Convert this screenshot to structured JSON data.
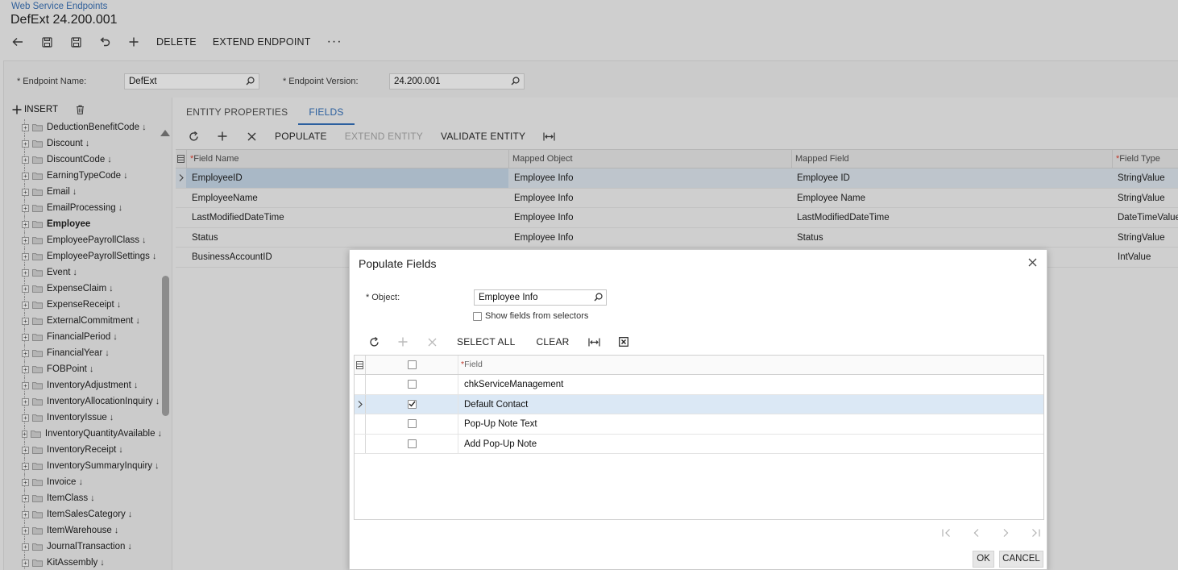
{
  "breadcrumb": "Web Service Endpoints",
  "title": "DefExt 24.200.001",
  "toolbar": {
    "delete_label": "DELETE",
    "extend_label": "EXTEND ENDPOINT",
    "more_label": "···"
  },
  "form": {
    "endpoint_name_label": "Endpoint Name:",
    "endpoint_name_value": "DefExt",
    "endpoint_version_label": "Endpoint Version:",
    "endpoint_version_value": "24.200.001",
    "required_mark": "*"
  },
  "tree": {
    "insert_label": "INSERT",
    "items": [
      {
        "label": "DeductionBenefitCode",
        "arrow": "↓",
        "bold": false
      },
      {
        "label": "Discount",
        "arrow": "↓",
        "bold": false
      },
      {
        "label": "DiscountCode",
        "arrow": "↓",
        "bold": false
      },
      {
        "label": "EarningTypeCode",
        "arrow": "↓",
        "bold": false
      },
      {
        "label": "Email",
        "arrow": "↓",
        "bold": false
      },
      {
        "label": "EmailProcessing",
        "arrow": "↓",
        "bold": false
      },
      {
        "label": "Employee",
        "arrow": "",
        "bold": true
      },
      {
        "label": "EmployeePayrollClass",
        "arrow": "↓",
        "bold": false
      },
      {
        "label": "EmployeePayrollSettings",
        "arrow": "↓",
        "bold": false
      },
      {
        "label": "Event",
        "arrow": "↓",
        "bold": false
      },
      {
        "label": "ExpenseClaim",
        "arrow": "↓",
        "bold": false
      },
      {
        "label": "ExpenseReceipt",
        "arrow": "↓",
        "bold": false
      },
      {
        "label": "ExternalCommitment",
        "arrow": "↓",
        "bold": false
      },
      {
        "label": "FinancialPeriod",
        "arrow": "↓",
        "bold": false
      },
      {
        "label": "FinancialYear",
        "arrow": "↓",
        "bold": false
      },
      {
        "label": "FOBPoint",
        "arrow": "↓",
        "bold": false
      },
      {
        "label": "InventoryAdjustment",
        "arrow": "↓",
        "bold": false
      },
      {
        "label": "InventoryAllocationInquiry",
        "arrow": "↓",
        "bold": false
      },
      {
        "label": "InventoryIssue",
        "arrow": "↓",
        "bold": false
      },
      {
        "label": "InventoryQuantityAvailable",
        "arrow": "↓",
        "bold": false
      },
      {
        "label": "InventoryReceipt",
        "arrow": "↓",
        "bold": false
      },
      {
        "label": "InventorySummaryInquiry",
        "arrow": "↓",
        "bold": false
      },
      {
        "label": "Invoice",
        "arrow": "↓",
        "bold": false
      },
      {
        "label": "ItemClass",
        "arrow": "↓",
        "bold": false
      },
      {
        "label": "ItemSalesCategory",
        "arrow": "↓",
        "bold": false
      },
      {
        "label": "ItemWarehouse",
        "arrow": "↓",
        "bold": false
      },
      {
        "label": "JournalTransaction",
        "arrow": "↓",
        "bold": false
      },
      {
        "label": "KitAssembly",
        "arrow": "↓",
        "bold": false
      }
    ]
  },
  "tabs": [
    {
      "label": "ENTITY PROPERTIES",
      "active": false
    },
    {
      "label": "FIELDS",
      "active": true
    }
  ],
  "grid_toolbar": {
    "populate_label": "POPULATE",
    "extend_entity_label": "EXTEND ENTITY",
    "validate_label": "VALIDATE ENTITY"
  },
  "grid": {
    "headers": {
      "field_name": "Field Name",
      "mapped_object": "Mapped Object",
      "mapped_field": "Mapped Field",
      "field_type": "Field Type"
    },
    "rows": [
      {
        "field_name": "EmployeeID",
        "mapped_object": "Employee Info",
        "mapped_field": "Employee ID",
        "field_type": "StringValue",
        "selected": true
      },
      {
        "field_name": "EmployeeName",
        "mapped_object": "Employee Info",
        "mapped_field": "Employee Name",
        "field_type": "StringValue",
        "selected": false
      },
      {
        "field_name": "LastModifiedDateTime",
        "mapped_object": "Employee Info",
        "mapped_field": "LastModifiedDateTime",
        "field_type": "DateTimeValue",
        "selected": false
      },
      {
        "field_name": "Status",
        "mapped_object": "Employee Info",
        "mapped_field": "Status",
        "field_type": "StringValue",
        "selected": false
      },
      {
        "field_name": "BusinessAccountID",
        "mapped_object": "",
        "mapped_field": "",
        "field_type": "IntValue",
        "selected": false
      }
    ]
  },
  "dialog": {
    "title": "Populate Fields",
    "object_label": "Object:",
    "object_value": "Employee Info",
    "show_selectors_label": "Show fields from selectors",
    "select_all_label": "SELECT ALL",
    "clear_label": "CLEAR",
    "field_header": "Field",
    "rows": [
      {
        "label": "chkServiceManagement",
        "checked": false,
        "selected": false
      },
      {
        "label": "Default Contact",
        "checked": true,
        "selected": true
      },
      {
        "label": "Pop-Up Note Text",
        "checked": false,
        "selected": false
      },
      {
        "label": "Add Pop-Up Note",
        "checked": false,
        "selected": false
      }
    ],
    "ok_label": "OK",
    "cancel_label": "CANCEL"
  },
  "colors": {
    "accent": "#2b5f9e",
    "required": "#c0392b",
    "selected_row": "#dbe8f5"
  }
}
